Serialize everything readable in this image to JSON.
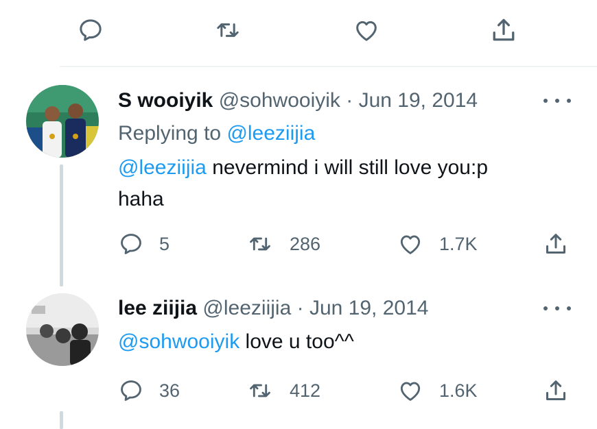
{
  "top_actions": {
    "icons": [
      "reply-icon",
      "retweet-icon",
      "like-icon",
      "share-icon"
    ]
  },
  "tweets": [
    {
      "name": "S wooiyik",
      "handle": "@sohwooiyik",
      "separator": "·",
      "date": "Jun 19, 2014",
      "replying_prefix": "Replying to",
      "replying_to": "@leeziijia",
      "mention": "@leeziijia",
      "text_line1": "nevermind i will still love you:p",
      "text_line2": "haha",
      "replies": "5",
      "retweets": "286",
      "likes": "1.7K"
    },
    {
      "name": "lee ziijia",
      "handle": "@leeziijia",
      "separator": "·",
      "date": "Jun 19, 2014",
      "mention": "@sohwooiyik",
      "text": "love u too^^",
      "replies": "36",
      "retweets": "412",
      "likes": "1.6K"
    }
  ],
  "colors": {
    "link": "#1d9bf0",
    "secondary_text": "#536471",
    "primary_text": "#0f1419",
    "thread_line": "#cfd9de"
  }
}
